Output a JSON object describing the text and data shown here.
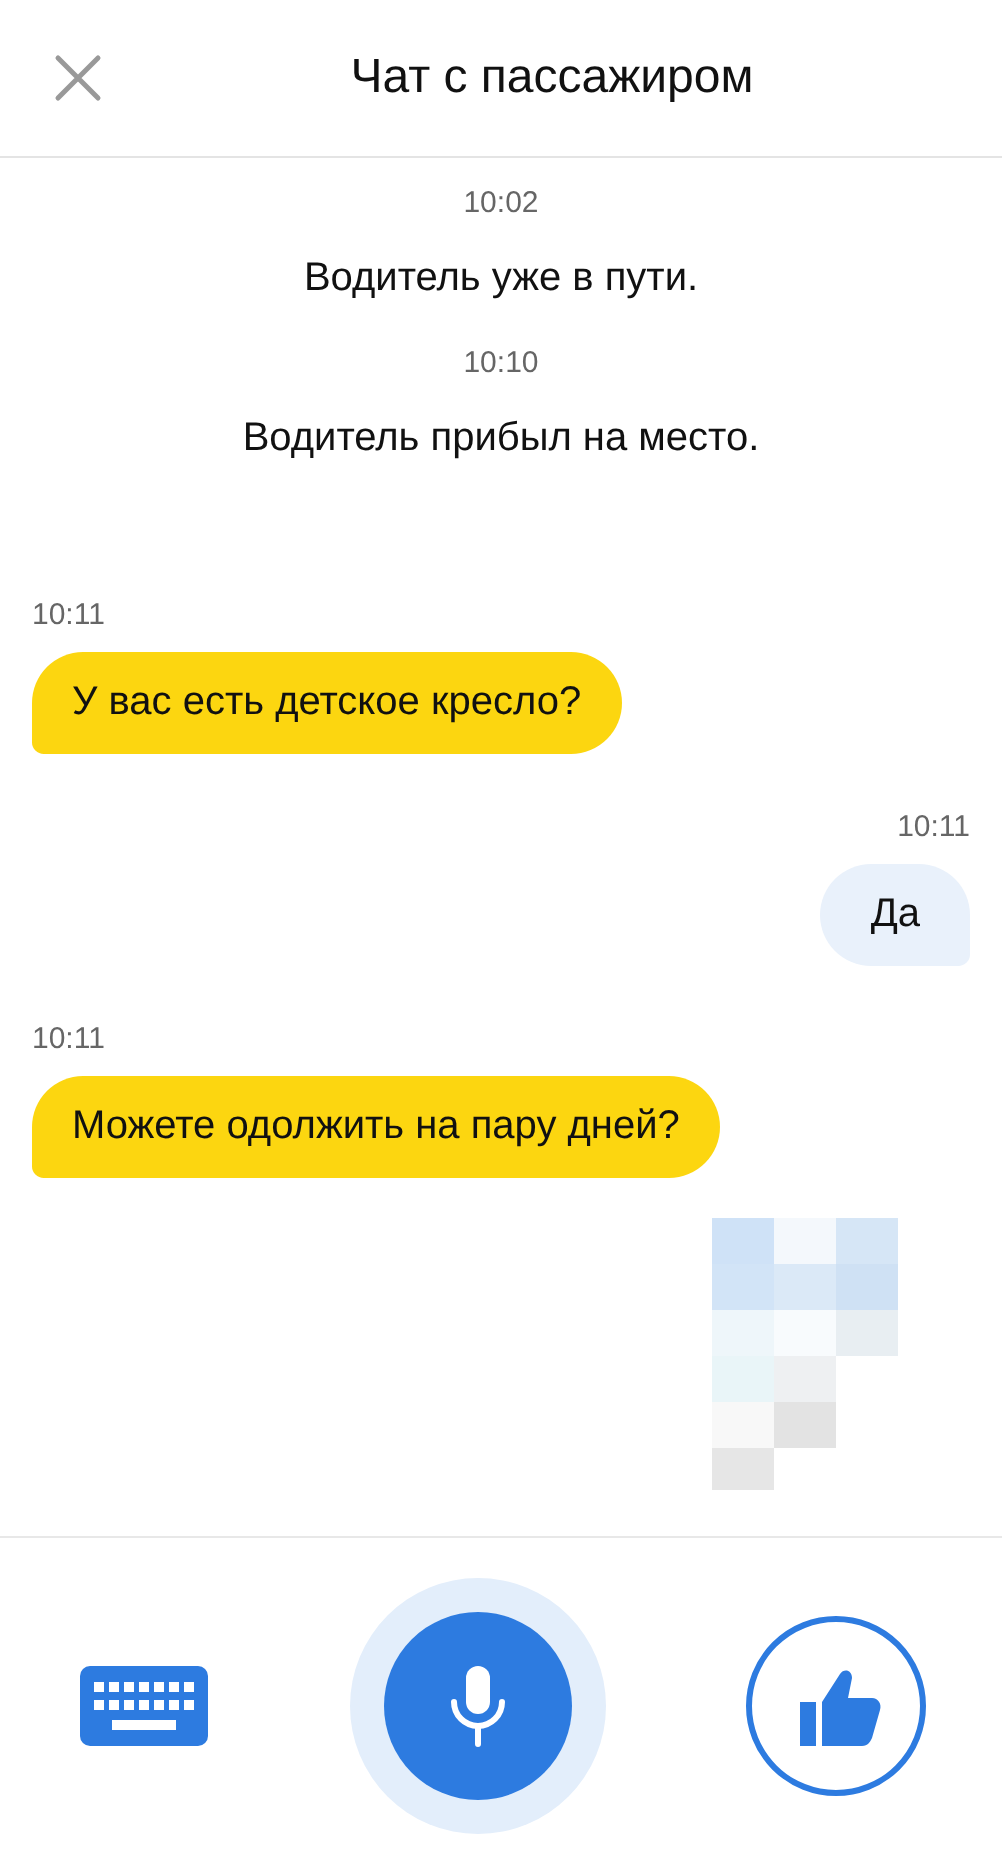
{
  "header": {
    "title": "Чат с пассажиром"
  },
  "messages": [
    {
      "kind": "system",
      "time": "10:02",
      "text": "Водитель уже в пути."
    },
    {
      "kind": "system",
      "time": "10:10",
      "text": "Водитель прибыл на место."
    },
    {
      "kind": "incoming",
      "time": "10:11",
      "text": "У вас есть детское кресло?"
    },
    {
      "kind": "outgoing",
      "time": "10:11",
      "text": "Да"
    },
    {
      "kind": "incoming",
      "time": "10:11",
      "text": "Можете одолжить на пару дней?"
    },
    {
      "kind": "hidden"
    }
  ]
}
